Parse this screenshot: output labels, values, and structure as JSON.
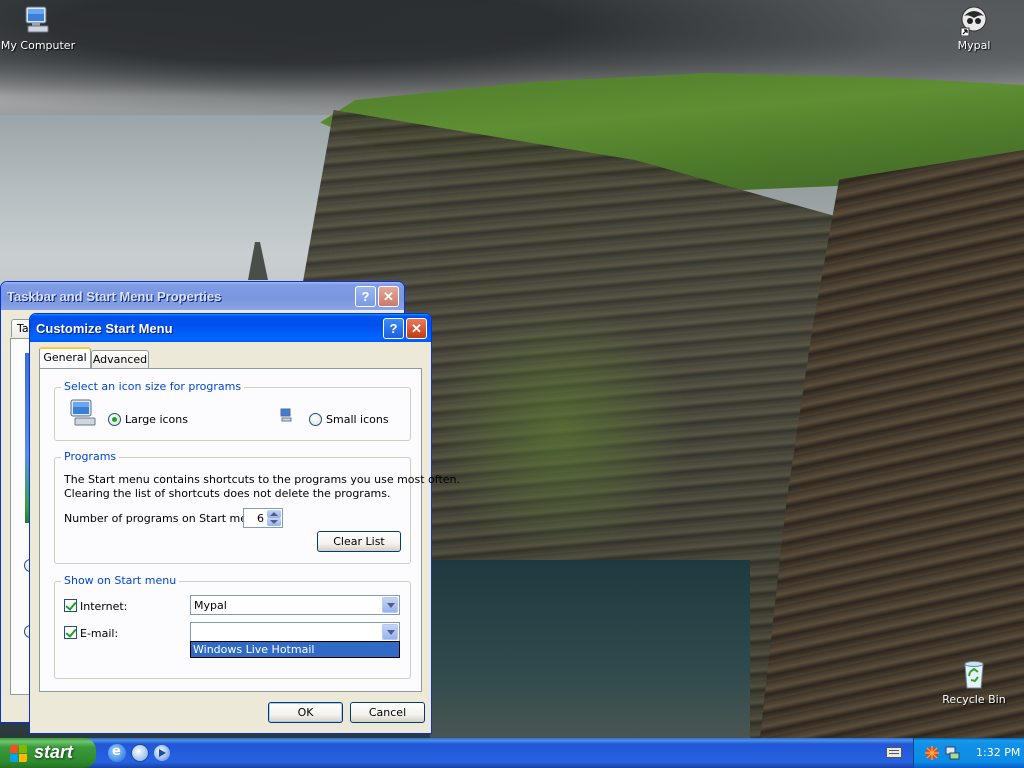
{
  "desktop": {
    "icons": {
      "my_computer": "My Computer",
      "mypal": "Mypal",
      "recycle_bin": "Recycle Bin"
    }
  },
  "taskbar_properties": {
    "title": "Taskbar and Start Menu Properties",
    "tab_fragment": "Ta"
  },
  "customize": {
    "title": "Customize Start Menu",
    "tabs": [
      "General",
      "Advanced"
    ],
    "icon_size": {
      "legend": "Select an icon size for programs",
      "large": "Large icons",
      "small": "Small icons",
      "selected": "large"
    },
    "programs": {
      "legend": "Programs",
      "description_line1": "The Start menu contains shortcuts to the programs you use most often.",
      "description_line2": "Clearing the list of shortcuts does not delete the programs.",
      "count_label": "Number of programs on Start menu:",
      "count_value": "6",
      "clear_button": "Clear List"
    },
    "show_on_start": {
      "legend": "Show on Start menu",
      "internet_label": "Internet:",
      "internet_checked": true,
      "internet_value": "Mypal",
      "email_label": "E-mail:",
      "email_checked": true,
      "email_value": "",
      "email_dropdown_option": "Windows Live Hotmail"
    },
    "ok_button": "OK",
    "cancel_button": "Cancel"
  },
  "taskbar": {
    "start_label": "start",
    "clock": "1:32 PM"
  },
  "colors": {
    "xp_blue": "#0054e3",
    "start_green": "#3a9a3a",
    "selection": "#316ac5"
  }
}
